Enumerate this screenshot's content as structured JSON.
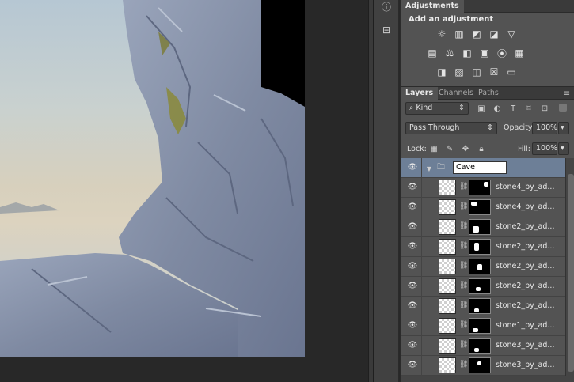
{
  "adjustments_panel": {
    "tab": "Adjustments",
    "title": "Add an adjustment",
    "row1": [
      "brightness-contrast-icon",
      "levels-icon",
      "curves-icon",
      "exposure-icon",
      "gradient-triangle-icon"
    ],
    "row2": [
      "vibrance-icon",
      "color-balance-icon",
      "black-white-icon",
      "photo-filter-icon",
      "channel-mixer-icon",
      "color-lookup-icon"
    ],
    "row3": [
      "invert-icon",
      "posterize-icon",
      "threshold-icon",
      "selective-color-icon",
      "gradient-map-icon"
    ]
  },
  "layers_panel": {
    "tabs": [
      "Layers",
      "Channels",
      "Paths"
    ],
    "filter_kind": "Kind",
    "blend_mode": "Pass Through",
    "opacity_label": "Opacity:",
    "opacity_value": "100%",
    "lock_label": "Lock:",
    "fill_label": "Fill:",
    "fill_value": "100%",
    "group": {
      "name": "Cave"
    },
    "layers": [
      {
        "name": "stone4_by_ad..."
      },
      {
        "name": "stone4_by_ad..."
      },
      {
        "name": "stone2_by_ad..."
      },
      {
        "name": "stone2_by_ad..."
      },
      {
        "name": "stone2_by_ad..."
      },
      {
        "name": "stone2_by_ad..."
      },
      {
        "name": "stone2_by_ad..."
      },
      {
        "name": "stone1_by_ad..."
      },
      {
        "name": "stone3_by_ad..."
      },
      {
        "name": "stone3_by_ad..."
      }
    ]
  },
  "icons": {
    "info": "info-icon",
    "adjust_panel": "panel-toggle-icon",
    "eye": "eye-icon",
    "folder": "folder-icon",
    "link": "link-icon"
  }
}
